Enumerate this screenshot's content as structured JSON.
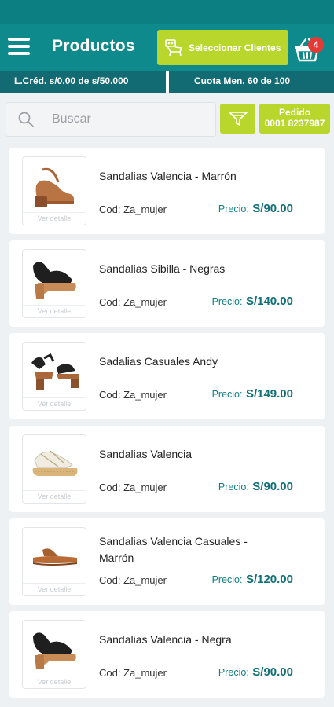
{
  "header": {
    "title": "Productos",
    "select_clients_label": "Seleccionar Clientes",
    "cart_count": "4"
  },
  "info": {
    "credit_line": "L.Créd. s/0.00 de s/50.000",
    "quota": "Cuota Men. 60 de 100"
  },
  "toolbar": {
    "search_placeholder": "Buscar",
    "order_label": "Pedido",
    "order_number": "0001 8237987"
  },
  "products": [
    {
      "name": "Sandalias Valencia - Marrón",
      "code": "Cod: Za_mujer",
      "price_label": "Precio:",
      "price": "S/90.00",
      "detail": "Ver detalle",
      "image_icon": "tan-platform-sandal-icon"
    },
    {
      "name": "Sandalias Sibilla - Negras",
      "code": "Cod: Za_mujer",
      "price_label": "Precio:",
      "price": "S/140.00",
      "detail": "Ver detalle",
      "image_icon": "black-wedge-sandal-icon"
    },
    {
      "name": "Sadalias Casuales  Andy",
      "code": "Cod: Za_mujer",
      "price_label": "Precio:",
      "price": "S/149.00",
      "detail": "Ver detalle",
      "image_icon": "black-strap-heel-sandal-icon"
    },
    {
      "name": "Sandalias Valencia",
      "code": "Cod: Za_mujer",
      "price_label": "Precio:",
      "price": "S/90.00",
      "detail": "Ver detalle",
      "image_icon": "white-espadrille-sandal-icon"
    },
    {
      "name": "Sandalias Valencia Casuales  - Marrón",
      "code": "Cod: Za_mujer",
      "price_label": "Precio:",
      "price": "S/120.00",
      "detail": "Ver detalle",
      "image_icon": "brown-flat-thong-sandal-icon"
    },
    {
      "name": "Sandalias Valencia - Negra",
      "code": "Cod: Za_mujer",
      "price_label": "Precio:",
      "price": "S/90.00",
      "detail": "Ver detalle",
      "image_icon": "black-wedge-sandal-icon"
    }
  ],
  "colors": {
    "primary": "#0f8a8c",
    "info_bar": "#126b73",
    "accent": "#b8d62b",
    "price": "#0f6f76",
    "badge": "#e53935"
  }
}
